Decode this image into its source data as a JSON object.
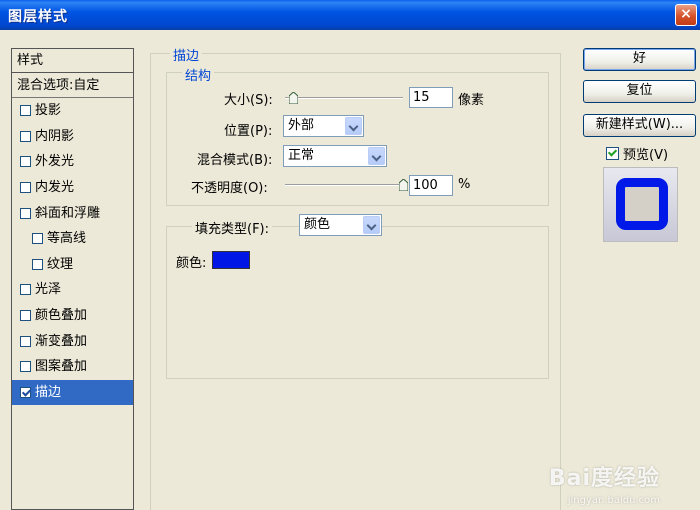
{
  "window": {
    "title": "图层样式",
    "close_label": "×"
  },
  "sidebar": {
    "header": "样式",
    "blend_options": "混合选项:自定",
    "items": [
      {
        "label": "投影",
        "checked": false
      },
      {
        "label": "内阴影",
        "checked": false
      },
      {
        "label": "外发光",
        "checked": false
      },
      {
        "label": "内发光",
        "checked": false
      },
      {
        "label": "斜面和浮雕",
        "checked": false
      },
      {
        "label": "等高线",
        "checked": false
      },
      {
        "label": "纹理",
        "checked": false
      },
      {
        "label": "光泽",
        "checked": false
      },
      {
        "label": "颜色叠加",
        "checked": false
      },
      {
        "label": "渐变叠加",
        "checked": false
      },
      {
        "label": "图案叠加",
        "checked": false
      },
      {
        "label": "描边",
        "checked": true
      }
    ]
  },
  "stroke": {
    "group_title": "描边",
    "structure_title": "结构",
    "size_label": "大小(S):",
    "size_value": "15",
    "size_unit": "像素",
    "size_slider_fraction": 0.07,
    "position_label": "位置(P):",
    "position_value": "外部",
    "blend_mode_label": "混合模式(B):",
    "blend_mode_value": "正常",
    "opacity_label": "不透明度(O):",
    "opacity_value": "100",
    "opacity_unit": "%",
    "opacity_slider_fraction": 1.0,
    "fill_type_label": "填充类型(F):",
    "fill_type_value": "颜色",
    "color_label": "颜色:",
    "color": "#0016e6"
  },
  "buttons": {
    "ok": "好",
    "reset": "复位",
    "new_style": "新建样式(W)...",
    "preview_label": "预览(V)",
    "preview_checked": true
  },
  "watermark": {
    "logo": "Bai度经验",
    "url": "jingyan.baidu.com"
  }
}
